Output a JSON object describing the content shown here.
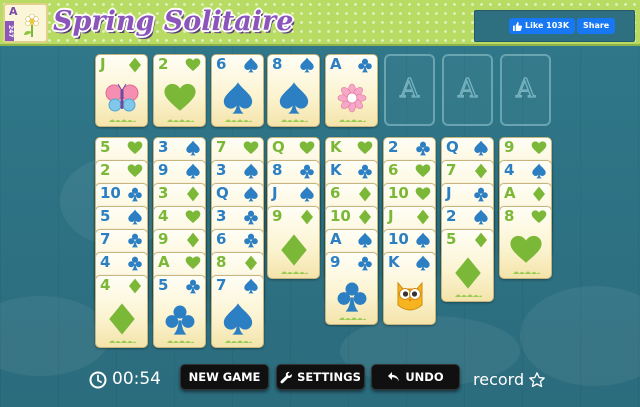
{
  "header": {
    "title": "Spring Solitaire",
    "logo_card": {
      "rank": "A",
      "band": "247"
    },
    "social": {
      "like_label": "Like 103K",
      "share_label": "Share"
    }
  },
  "foundations": [
    {
      "label": "A",
      "empty": false,
      "card": {
        "rank": "A",
        "suit": "clubs"
      }
    },
    {
      "label": "A",
      "empty": true
    },
    {
      "label": "A",
      "empty": true
    },
    {
      "label": "A",
      "empty": true
    }
  ],
  "free_cells": [
    {
      "rank": "J",
      "suit": "diamonds"
    },
    {
      "rank": "2",
      "suit": "hearts"
    },
    {
      "rank": "6",
      "suit": "spades"
    },
    {
      "rank": "8",
      "suit": "spades"
    }
  ],
  "tableau": [
    {
      "cards": [
        {
          "rank": "5",
          "suit": "hearts"
        },
        {
          "rank": "2",
          "suit": "hearts"
        },
        {
          "rank": "10",
          "suit": "clubs"
        },
        {
          "rank": "5",
          "suit": "spades"
        },
        {
          "rank": "7",
          "suit": "clubs"
        },
        {
          "rank": "4",
          "suit": "clubs"
        },
        {
          "rank": "4",
          "suit": "diamonds"
        }
      ]
    },
    {
      "cards": [
        {
          "rank": "3",
          "suit": "spades"
        },
        {
          "rank": "9",
          "suit": "spades"
        },
        {
          "rank": "3",
          "suit": "diamonds"
        },
        {
          "rank": "4",
          "suit": "hearts"
        },
        {
          "rank": "9",
          "suit": "diamonds"
        },
        {
          "rank": "A",
          "suit": "hearts"
        },
        {
          "rank": "5",
          "suit": "clubs"
        }
      ]
    },
    {
      "cards": [
        {
          "rank": "7",
          "suit": "hearts"
        },
        {
          "rank": "3",
          "suit": "spades"
        },
        {
          "rank": "Q",
          "suit": "spades"
        },
        {
          "rank": "3",
          "suit": "clubs"
        },
        {
          "rank": "6",
          "suit": "clubs"
        },
        {
          "rank": "8",
          "suit": "diamonds"
        },
        {
          "rank": "7",
          "suit": "spades"
        }
      ]
    },
    {
      "cards": [
        {
          "rank": "Q",
          "suit": "hearts"
        },
        {
          "rank": "8",
          "suit": "clubs"
        },
        {
          "rank": "J",
          "suit": "spades"
        },
        {
          "rank": "9",
          "suit": "diamonds"
        }
      ]
    },
    {
      "cards": [
        {
          "rank": "K",
          "suit": "hearts"
        },
        {
          "rank": "K",
          "suit": "clubs"
        },
        {
          "rank": "6",
          "suit": "diamonds"
        },
        {
          "rank": "10",
          "suit": "diamonds"
        },
        {
          "rank": "A",
          "suit": "spades"
        },
        {
          "rank": "9",
          "suit": "clubs"
        }
      ]
    },
    {
      "cards": [
        {
          "rank": "2",
          "suit": "clubs"
        },
        {
          "rank": "6",
          "suit": "hearts"
        },
        {
          "rank": "10",
          "suit": "hearts"
        },
        {
          "rank": "J",
          "suit": "diamonds"
        },
        {
          "rank": "10",
          "suit": "spades"
        },
        {
          "rank": "K",
          "suit": "spades"
        }
      ]
    },
    {
      "cards": [
        {
          "rank": "Q",
          "suit": "spades"
        },
        {
          "rank": "7",
          "suit": "diamonds"
        },
        {
          "rank": "J",
          "suit": "clubs"
        },
        {
          "rank": "2",
          "suit": "spades"
        },
        {
          "rank": "5",
          "suit": "diamonds"
        }
      ]
    },
    {
      "cards": [
        {
          "rank": "9",
          "suit": "hearts"
        },
        {
          "rank": "4",
          "suit": "spades"
        },
        {
          "rank": "A",
          "suit": "diamonds"
        },
        {
          "rank": "8",
          "suit": "hearts"
        }
      ]
    }
  ],
  "footer": {
    "timer": "00:54",
    "new_game_label": "NEW GAME",
    "settings_label": "SETTINGS",
    "undo_label": "UNDO",
    "record_label": "record"
  },
  "colors": {
    "green_suit": "#7cb838",
    "blue_suit": "#2b7fc2",
    "title_purple": "#8c55bc",
    "header_green": "#b7db63",
    "felt": "#2f7587"
  },
  "icons": {
    "timer": "clock-icon",
    "settings": "wrench-icon",
    "undo": "undo-arrow-icon",
    "record": "star-icon",
    "like": "thumbs-up-icon"
  }
}
